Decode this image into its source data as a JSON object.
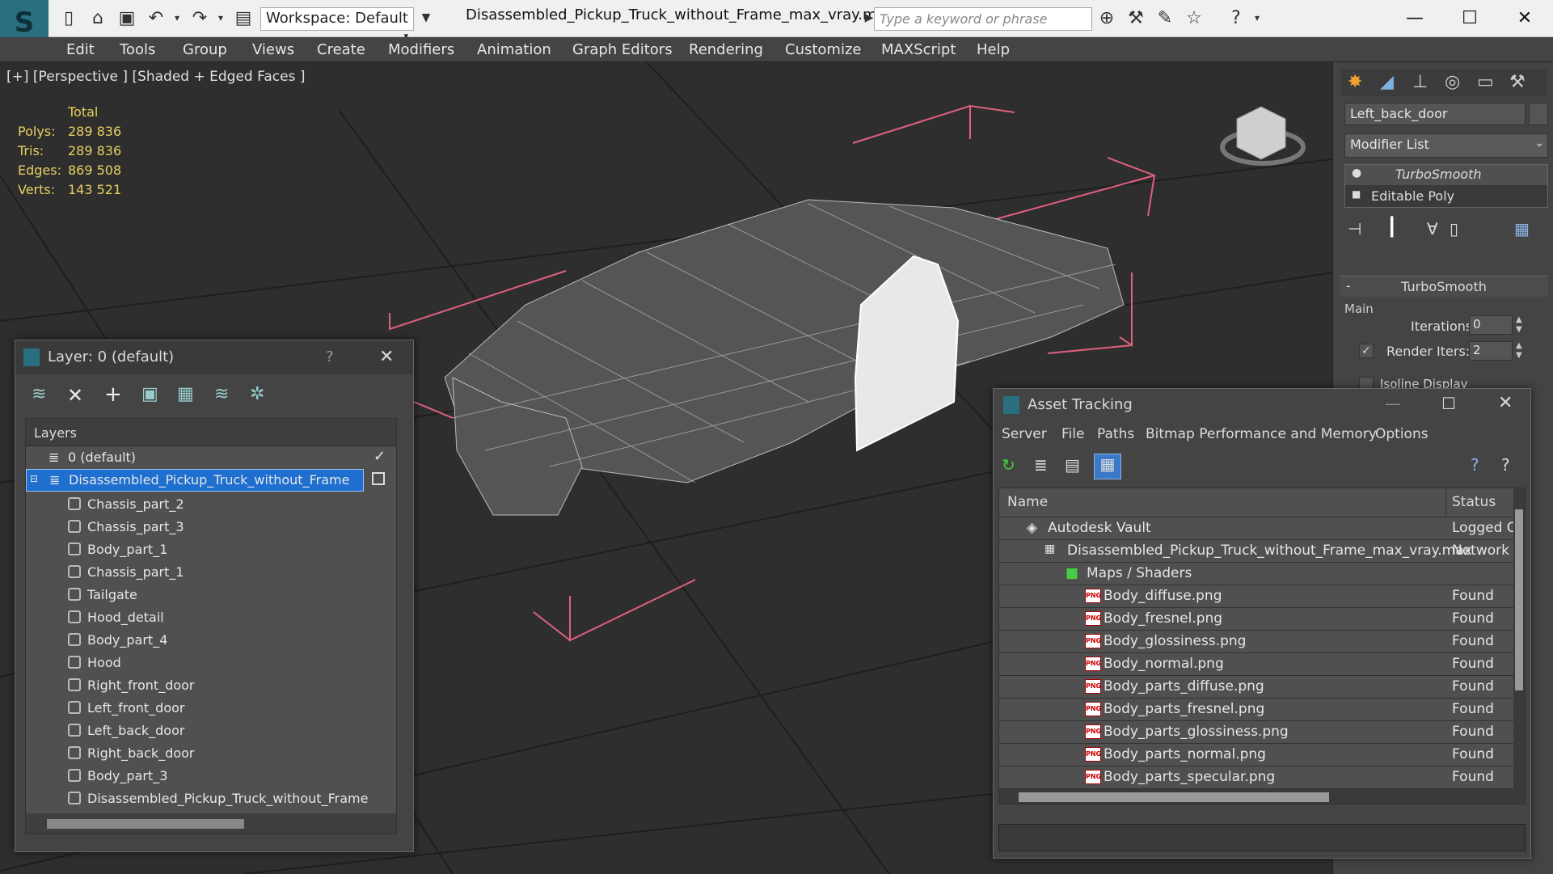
{
  "app": {
    "workspace": "Workspace: Default",
    "title": "Disassembled_Pickup_Truck_without_Frame_max_vray.max",
    "search_placeholder": "Type a keyword or phrase"
  },
  "menu": [
    "Edit",
    "Tools",
    "Group",
    "Views",
    "Create",
    "Modifiers",
    "Animation",
    "Graph Editors",
    "Rendering",
    "Customize",
    "MAXScript",
    "Help"
  ],
  "viewport": {
    "label": "[+] [Perspective ] [Shaded + Edged Faces ]",
    "stats_header": "Total",
    "stats": [
      {
        "label": "Polys:",
        "value": "289 836"
      },
      {
        "label": "Tris:",
        "value": "289 836"
      },
      {
        "label": "Edges:",
        "value": "869 508"
      },
      {
        "label": "Verts:",
        "value": "143 521"
      }
    ]
  },
  "command_panel": {
    "object_name": "Left_back_door",
    "modifier_list": "Modifier List",
    "stack": [
      "TurboSmooth",
      "Editable Poly"
    ],
    "rollout_title": "TurboSmooth",
    "group_main": "Main",
    "iterations_label": "Iterations:",
    "iterations_value": "0",
    "render_iters_label": "Render Iters:",
    "render_iters_value": "2",
    "isoline_label": "Isoline Display"
  },
  "layer_dialog": {
    "title": "Layer: 0 (default)",
    "help": "?",
    "column": "Layers",
    "layers": [
      {
        "name": "0 (default)"
      },
      {
        "name": "Disassembled_Pickup_Truck_without_Frame"
      }
    ],
    "objects": [
      "Chassis_part_2",
      "Chassis_part_3",
      "Body_part_1",
      "Chassis_part_1",
      "Tailgate",
      "Hood_detail",
      "Body_part_4",
      "Hood",
      "Right_front_door",
      "Left_front_door",
      "Left_back_door",
      "Right_back_door",
      "Body_part_3",
      "Disassembled_Pickup_Truck_without_Frame"
    ]
  },
  "asset_tracking": {
    "title": "Asset Tracking",
    "menu": [
      "Server",
      "File",
      "Paths",
      "Bitmap Performance and Memory",
      "Options"
    ],
    "col_name": "Name",
    "col_status": "Status",
    "vault": {
      "name": "Autodesk Vault",
      "status": "Logged O"
    },
    "file": {
      "name": "Disassembled_Pickup_Truck_without_Frame_max_vray.max",
      "status": "Network"
    },
    "maps": {
      "name": "Maps / Shaders",
      "status": ""
    },
    "png_badge": "PNG",
    "textures": [
      {
        "name": "Body_diffuse.png",
        "status": "Found"
      },
      {
        "name": "Body_fresnel.png",
        "status": "Found"
      },
      {
        "name": "Body_glossiness.png",
        "status": "Found"
      },
      {
        "name": "Body_normal.png",
        "status": "Found"
      },
      {
        "name": "Body_parts_diffuse.png",
        "status": "Found"
      },
      {
        "name": "Body_parts_fresnel.png",
        "status": "Found"
      },
      {
        "name": "Body_parts_glossiness.png",
        "status": "Found"
      },
      {
        "name": "Body_parts_normal.png",
        "status": "Found"
      },
      {
        "name": "Body_parts_specular.png",
        "status": "Found"
      }
    ]
  }
}
